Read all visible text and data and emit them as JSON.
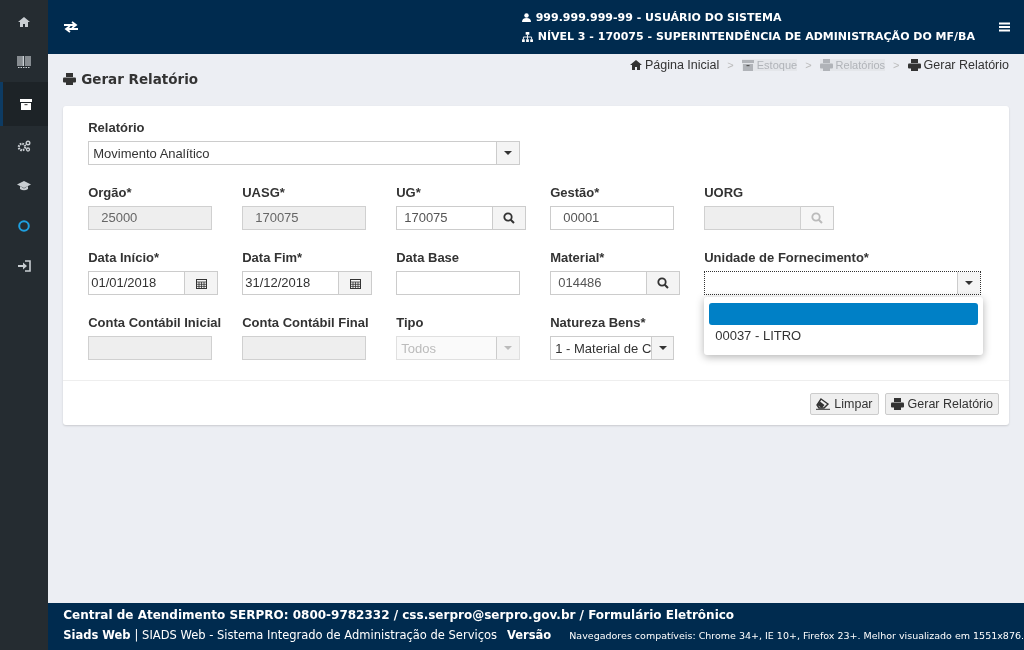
{
  "sidebar": {
    "items": [
      {
        "kind": "home",
        "selected": false
      },
      {
        "kind": "barcode",
        "selected": false
      },
      {
        "kind": "archive",
        "selected": true
      },
      {
        "kind": "gears",
        "selected": false
      },
      {
        "kind": "cap",
        "selected": false
      },
      {
        "kind": "ring",
        "selected": false
      },
      {
        "kind": "signin",
        "selected": false
      }
    ]
  },
  "header": {
    "user": "999.999.999-99 - USUÁRIO DO SISTEMA",
    "unit": "NÍVEL 3 - 170075 - SUPERINTENDÊNCIA DE ADMINISTRAÇÃO DO MF/BA"
  },
  "page_title": "Gerar Relatório",
  "breadcrumb": [
    {
      "label": "Página Inicial",
      "kind": "home",
      "disabled": false
    },
    {
      "label": "Estoque",
      "kind": "archive",
      "disabled": true
    },
    {
      "label": "Relatórios",
      "kind": "print",
      "disabled": true
    },
    {
      "label": "Gerar Relatório",
      "kind": "print",
      "disabled": false
    }
  ],
  "breadcrumb_separator": ">",
  "report": {
    "label": "Relatório",
    "value": "Movimento Analítico"
  },
  "rows": [
    [
      {
        "label": "Orgão*",
        "kind": "text",
        "value": "25000",
        "disabled": true
      },
      {
        "label": "UASG*",
        "kind": "text",
        "value": "170075",
        "disabled": true
      },
      {
        "label": "UG*",
        "kind": "lookup",
        "value": "170075",
        "disabled": false
      },
      {
        "label": "Gestão*",
        "kind": "text",
        "value": "00001",
        "disabled": false
      },
      {
        "label": "UORG",
        "kind": "lookup",
        "disabled": true
      }
    ],
    [
      {
        "label": "Data Início*",
        "kind": "date",
        "value": "01/01/2018",
        "disabled": false
      },
      {
        "label": "Data Fim*",
        "kind": "date",
        "value": "31/12/2018",
        "disabled": false
      },
      {
        "label": "Data Base",
        "kind": "text",
        "disabled": false
      },
      {
        "label": "Material*",
        "kind": "lookup",
        "value": "014486",
        "disabled": false
      },
      {
        "label": "Unidade de Fornecimento*",
        "kind": "combo",
        "expanded": true,
        "options": [
          {
            "selected": true
          },
          {
            "label": "00037 - LITRO",
            "selected": false
          }
        ]
      }
    ],
    [
      {
        "label": "Conta Contábil Inicial",
        "kind": "text",
        "disabled": true
      },
      {
        "label": "Conta Contábil Final",
        "kind": "text",
        "disabled": true
      },
      {
        "label": "Tipo",
        "kind": "select",
        "value": "Todos",
        "disabled": true
      },
      {
        "label": "Natureza Bens*",
        "kind": "select",
        "value": "1 - Material de C",
        "disabled": false
      }
    ]
  ],
  "buttons": [
    {
      "label": "Limpar",
      "kind": "eraser"
    },
    {
      "label": "Gerar Relatório",
      "kind": "print"
    }
  ],
  "footer": {
    "contact": "Central de Atendimento SERPRO: 0800-9782332 / css.serpro@serpro.gov.br / Formulário Eletrônico",
    "app": "Siads Web",
    "app_full": "| SIADS Web - Sistema Integrado de Administração de Serviços",
    "version": "Versão",
    "browsers": "Navegadores compatíveis: Chrome 34+, IE 10+, Firefox 23+. Melhor visualizado em 1551x876."
  }
}
